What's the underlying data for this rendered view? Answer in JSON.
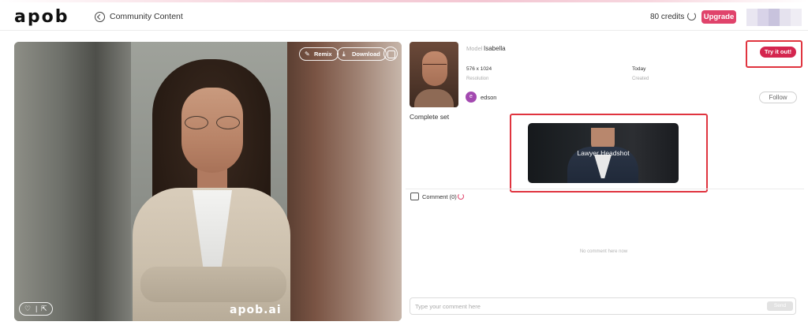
{
  "header": {
    "logo": "apob",
    "back_label": "Community Content",
    "credits": "80 credits",
    "upgrade_label": "Upgrade"
  },
  "image": {
    "remix_label": "Remix",
    "download_label": "Download",
    "watermark": "apob.ai"
  },
  "details": {
    "model_label": "Model",
    "model_value": "Isabella",
    "try_label": "Try it out!",
    "resolution_value": "576 x 1024",
    "resolution_label": "Resolution",
    "created_value": "Today",
    "created_label": "Created",
    "user_initial": "e",
    "user_name": "edson",
    "follow_label": "Follow",
    "set_label": "Complete set",
    "set_card_label": "Lawyer Headshot"
  },
  "comments": {
    "title": "Comment (0)",
    "empty_text": "No comment here now",
    "placeholder": "Type your comment here",
    "send_label": "Send"
  },
  "colors": {
    "accent": "#e0436b",
    "try_button": "#d4264f",
    "highlight": "#e0343f"
  }
}
